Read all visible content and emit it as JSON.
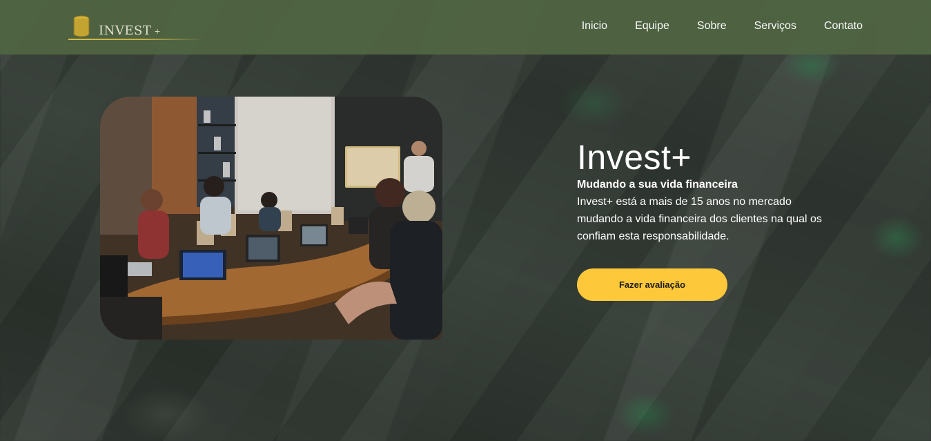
{
  "header": {
    "logo_text": "INVEST",
    "logo_plus": "+",
    "nav": [
      {
        "label": "Inicio"
      },
      {
        "label": "Equipe"
      },
      {
        "label": "Sobre"
      },
      {
        "label": "Serviços"
      },
      {
        "label": "Contato"
      }
    ]
  },
  "hero": {
    "title": "Invest+",
    "subtitle": "Mudando a sua vida financeira",
    "description": "Invest+ está a mais de 15 anos no mercado mudando a vida financeira dos clientes na qual os confiam esta responsabilidade.",
    "cta_label": "Fazer avaliação",
    "image_icon": "meeting-photo"
  },
  "colors": {
    "navbar": "#4f6442",
    "accent": "#fdc93a",
    "logo_gold": "#d8c24a",
    "text": "#ffffff"
  }
}
